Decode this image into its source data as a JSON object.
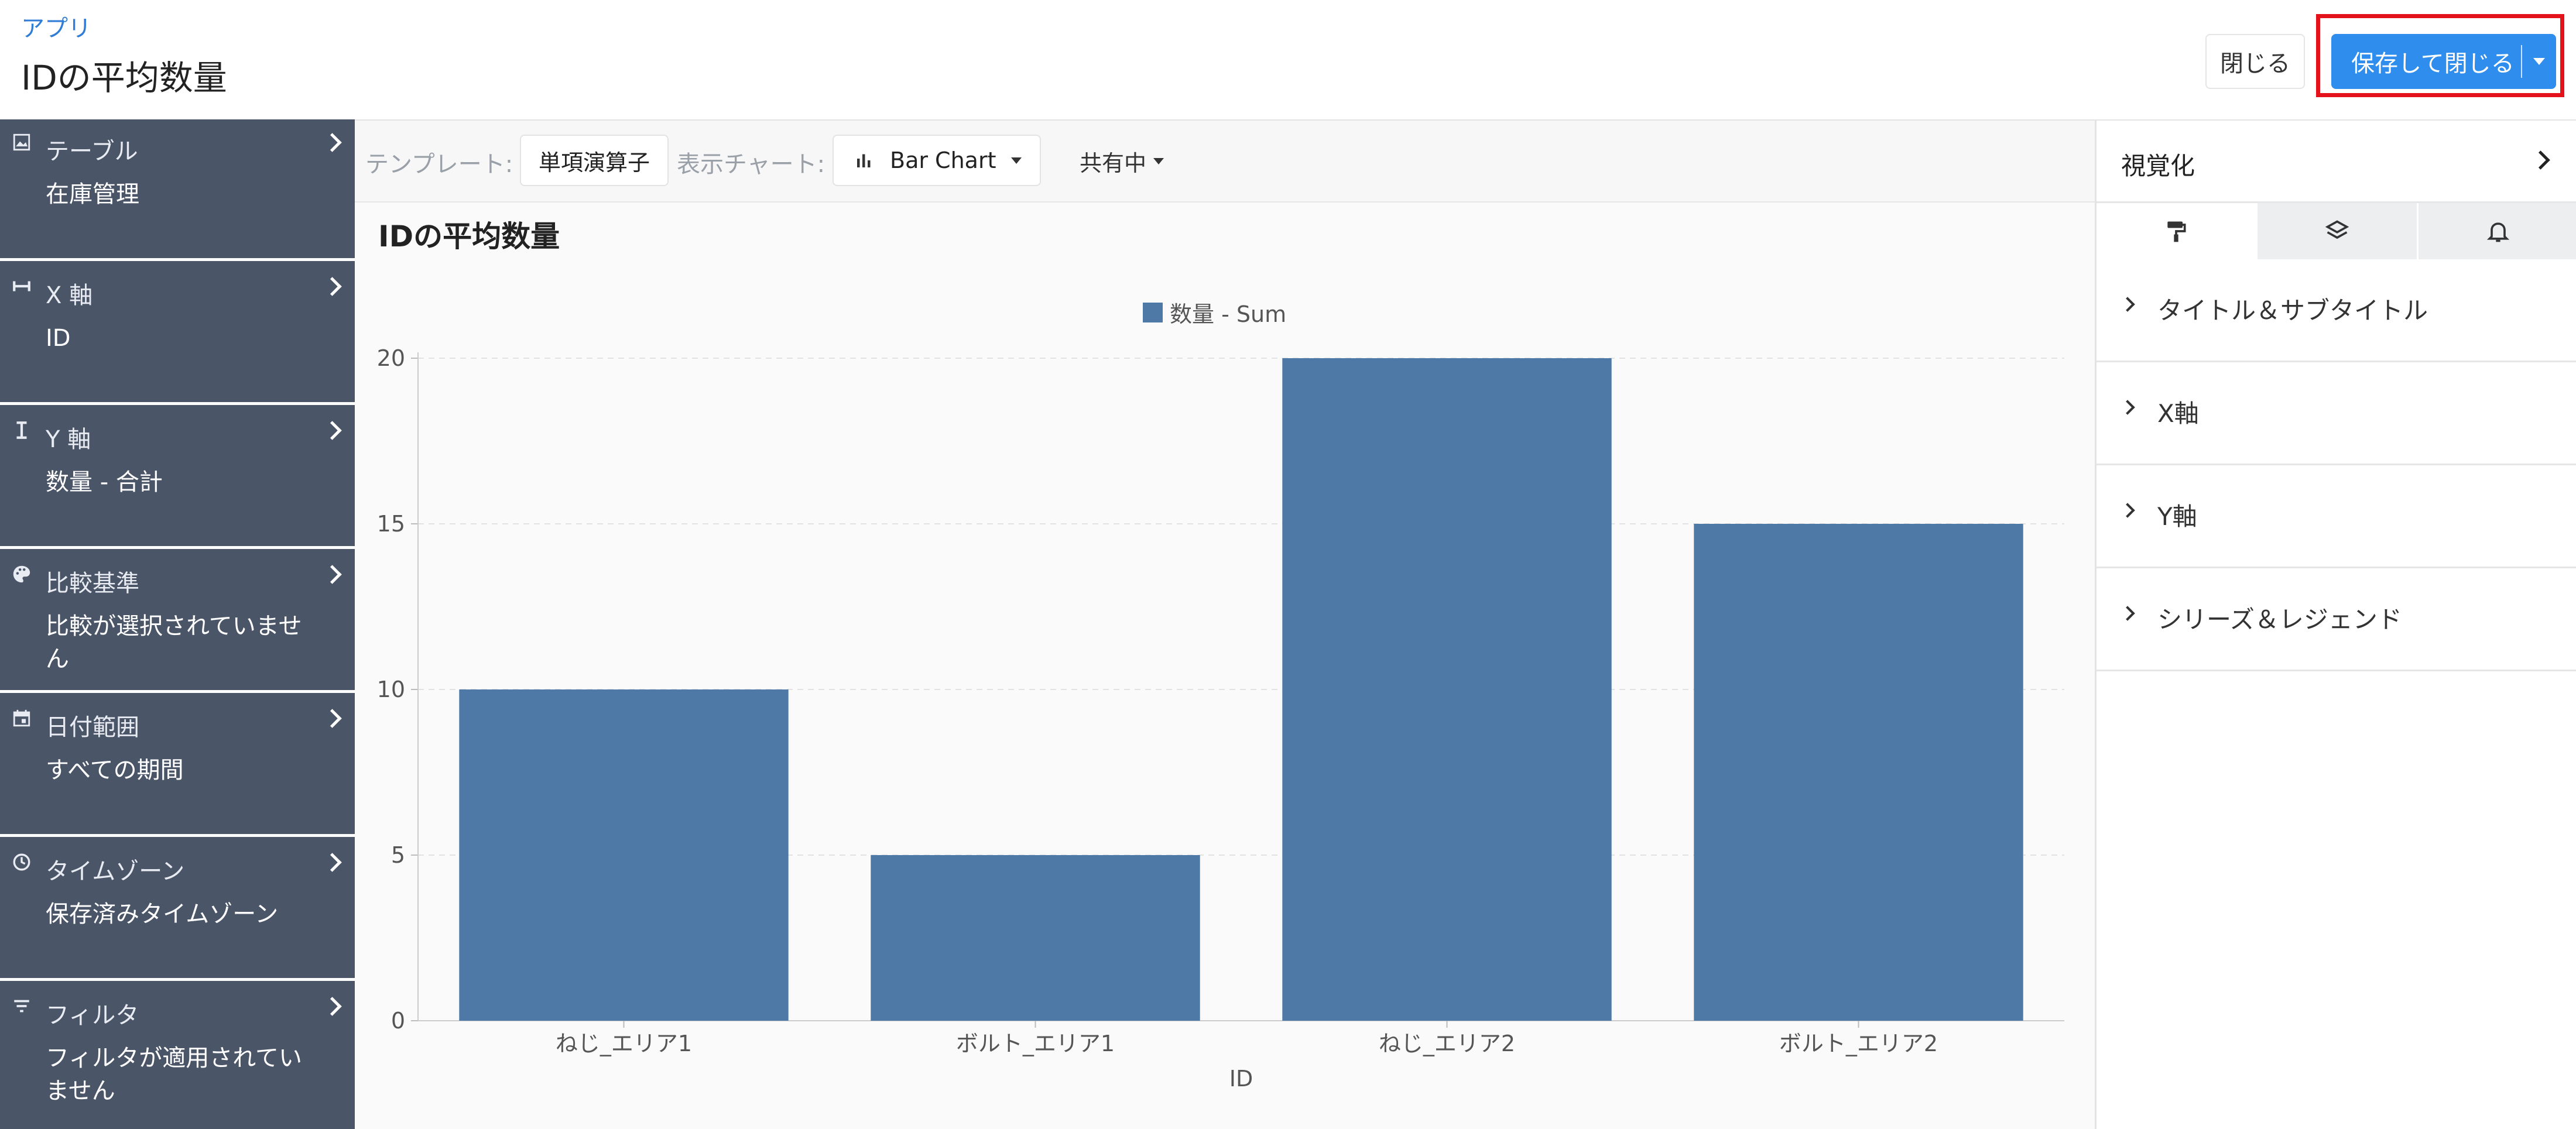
{
  "header": {
    "breadcrumb": "アプリ",
    "title": "IDの平均数量",
    "close_label": "閉じる",
    "save_label": "保存して閉じる"
  },
  "sidebar": {
    "items": [
      {
        "icon": "image-icon",
        "label": "テーブル",
        "value": "在庫管理"
      },
      {
        "icon": "x-axis-icon",
        "label": "X 軸",
        "value": "ID"
      },
      {
        "icon": "y-axis-icon",
        "label": "Y 軸",
        "value": "数量 - 合計"
      },
      {
        "icon": "palette-icon",
        "label": "比較基準",
        "value": "比較が選択されていません"
      },
      {
        "icon": "calendar-icon",
        "label": "日付範囲",
        "value": "すべての期間"
      },
      {
        "icon": "clock-icon",
        "label": "タイムゾーン",
        "value": "保存済みタイムゾーン"
      },
      {
        "icon": "filter-icon",
        "label": "フィルタ",
        "value": "フィルタが適用されていません"
      }
    ]
  },
  "toolbar": {
    "template_label": "テンプレート:",
    "template_value": "単項演算子",
    "chart_label": "表示チャート:",
    "chart_value": "Bar Chart",
    "share_label": "共有中"
  },
  "right_panel": {
    "title": "視覚化",
    "tabs": [
      "paint-roller-icon",
      "layers-icon",
      "bell-icon"
    ],
    "sections": [
      {
        "label": "タイトル＆サブタイトル"
      },
      {
        "label": "X軸"
      },
      {
        "label": "Y軸"
      },
      {
        "label": "シリーズ＆レジェンド"
      }
    ]
  },
  "colors": {
    "bar": "#4e79a7",
    "primary_button": "#2f8ded",
    "sidebar_bg": "#4b5568",
    "highlight": "#e3121b"
  },
  "chart_data": {
    "type": "bar",
    "title": "IDの平均数量",
    "categories": [
      "ねじ_エリア1",
      "ボルト_エリア1",
      "ねじ_エリア2",
      "ボルト_エリア2"
    ],
    "series": [
      {
        "name": "数量 - Sum",
        "values": [
          10,
          5,
          20,
          15
        ]
      }
    ],
    "xlabel": "ID",
    "ylabel": "",
    "ylim": [
      0,
      20
    ],
    "yticks": [
      0,
      5,
      10,
      15,
      20
    ],
    "grid": true,
    "legend_position": "top-center"
  }
}
